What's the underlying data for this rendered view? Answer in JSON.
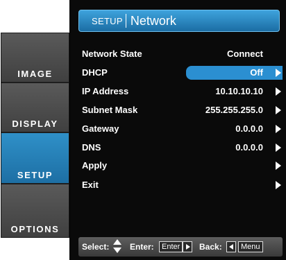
{
  "tabs": [
    {
      "label": "IMAGE",
      "active": false
    },
    {
      "label": "DISPLAY",
      "active": false
    },
    {
      "label": "SETUP",
      "active": true
    },
    {
      "label": "OPTIONS",
      "active": false
    }
  ],
  "header": {
    "section": "SETUP",
    "title": "Network"
  },
  "rows": [
    {
      "label": "Network State",
      "value": "Connect",
      "arrow": false,
      "highlighted": false
    },
    {
      "label": "DHCP",
      "value": "Off",
      "arrow": true,
      "highlighted": true
    },
    {
      "label": "IP Address",
      "value": "10.10.10.10",
      "arrow": true,
      "highlighted": false
    },
    {
      "label": "Subnet Mask",
      "value": "255.255.255.0",
      "arrow": true,
      "highlighted": false
    },
    {
      "label": "Gateway",
      "value": "0.0.0.0",
      "arrow": true,
      "highlighted": false
    },
    {
      "label": "DNS",
      "value": "0.0.0.0",
      "arrow": true,
      "highlighted": false
    },
    {
      "label": "Apply",
      "value": "",
      "arrow": true,
      "highlighted": false
    },
    {
      "label": "Exit",
      "value": "",
      "arrow": true,
      "highlighted": false
    }
  ],
  "footer": {
    "select_label": "Select:",
    "enter_label": "Enter:",
    "enter_key": "Enter",
    "back_label": "Back:",
    "menu_key": "Menu"
  },
  "colors": {
    "accent": "#2b8fd1",
    "panel_bg": "#0a0a0a",
    "tab_bg": "#4a4a4a",
    "text": "#ffffff"
  }
}
